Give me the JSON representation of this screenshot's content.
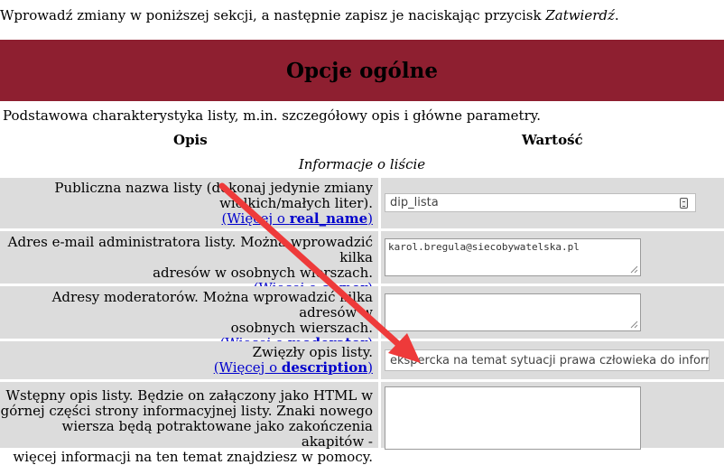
{
  "intro": {
    "text": "Wprowadź zmiany w poniższej sekcji, a następnie zapisz je naciskając przycisk ",
    "button_ref": "Zatwierdź",
    "tail": "."
  },
  "section": {
    "title": "Opcje ogólne",
    "description": "Podstawowa charakterystyka listy, m.in. szczegółowy opis i główne parametry."
  },
  "columns": {
    "left": "Opis",
    "right": "Wartość"
  },
  "group_caption": "Informacje o liście",
  "more_prefix": "(Więcej o ",
  "more_suffix": ")",
  "rows": [
    {
      "label_lines": [
        "Publiczna nazwa listy (dokonaj jedynie zmiany",
        "wielkich/małych liter)."
      ],
      "more_key": "real_name",
      "value": "dip_lista"
    },
    {
      "label_lines": [
        "Adres e-mail administratora listy. Można wprowadzić kilka",
        "adresów w osobnych wierszach."
      ],
      "more_key": "owner",
      "value": "karol.bregula@siecobywatelska.pl"
    },
    {
      "label_lines": [
        "Adresy moderatorów. Można wprowadzić kilka adresów w",
        "osobnych wierszach."
      ],
      "more_key": "moderator",
      "value": ""
    },
    {
      "label_lines": [
        "Zwięzły opis listy."
      ],
      "more_key": "description",
      "value": "ekspercka na temat sytuacji prawa człowieka do informacji"
    },
    {
      "label_lines": [
        "Wstępny opis listy. Będzie on załączony jako HTML w",
        "górnej części strony informacyjnej listy. Znaki nowego",
        "wiersza będą potraktowane jako zakończenia akapitów -",
        "więcej informacji na ten temat znajdziesz w pomocy."
      ],
      "more_key": "",
      "value": ""
    }
  ],
  "colors": {
    "banner": "#8e1f30",
    "cell": "#dcdcdc",
    "link": "#0000cc",
    "arrow": "#ee3a3a"
  }
}
